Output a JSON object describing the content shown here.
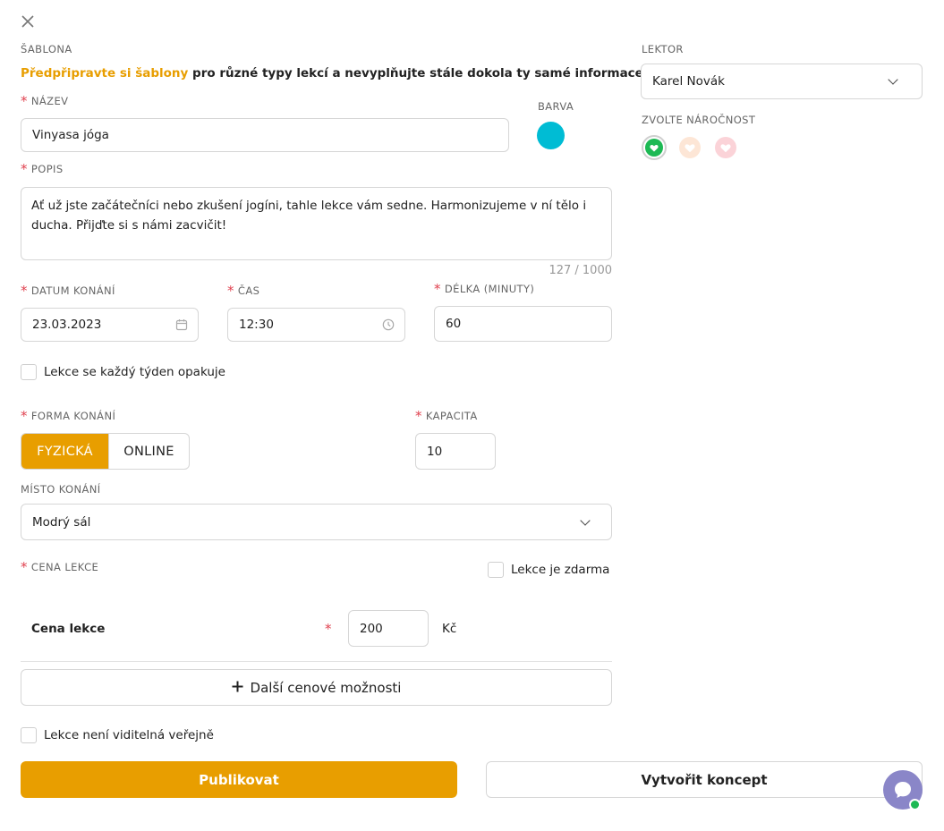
{
  "template": {
    "label": "ŠABLONA",
    "link_text": "Předpřipravte si šablony",
    "rest_text": " pro různé typy lekcí a nevyplňujte stále dokola ty samé informace."
  },
  "name": {
    "label": "NÁZEV",
    "value": "Vinyasa jóga"
  },
  "color": {
    "label": "BARVA",
    "value": "#00bcd4"
  },
  "description": {
    "label": "POPIS",
    "value": "Ať už jste začátečníci nebo zkušení jogíni, tahle lekce vám sedne. Harmonizujeme v ní tělo i ducha. Přijďte si s námi zacvičit!",
    "counter": "127 / 1000"
  },
  "date": {
    "label": "DATUM KONÁNÍ",
    "value": "23.03.2023"
  },
  "time": {
    "label": "ČAS",
    "value": "12:30"
  },
  "duration": {
    "label": "DÉLKA (MINUTY)",
    "value": "60"
  },
  "repeat": {
    "label": "Lekce se každý týden opakuje"
  },
  "form": {
    "label": "FORMA KONÁNÍ",
    "options": [
      "FYZICKÁ",
      "ONLINE"
    ],
    "selected": "FYZICKÁ"
  },
  "capacity": {
    "label": "KAPACITA",
    "value": "10"
  },
  "place": {
    "label": "MÍSTO KONÁNÍ",
    "value": "Modrý sál"
  },
  "price": {
    "label": "CENA LEKCE",
    "free_label": "Lekce je zdarma",
    "row_label": "Cena lekce",
    "value": "200",
    "currency": "Kč",
    "more_label": "Další cenové možnosti"
  },
  "hidden": {
    "label": "Lekce není viditelná veřejně"
  },
  "publish_label": "Publikovat",
  "draft_label": "Vytvořit koncept",
  "lecturer": {
    "label": "LEKTOR",
    "value": "Karel Novák"
  },
  "difficulty": {
    "label": "ZVOLTE NÁROČNOST",
    "levels": [
      {
        "name": "easy",
        "color": "#1db954"
      },
      {
        "name": "medium",
        "color": "#f6b98a"
      },
      {
        "name": "hard",
        "color": "#f08a94"
      }
    ]
  },
  "colors": {
    "accent": "#e89e00",
    "required": "#e0414f",
    "chat": "#8a86c8",
    "online_dot": "#1db954"
  }
}
